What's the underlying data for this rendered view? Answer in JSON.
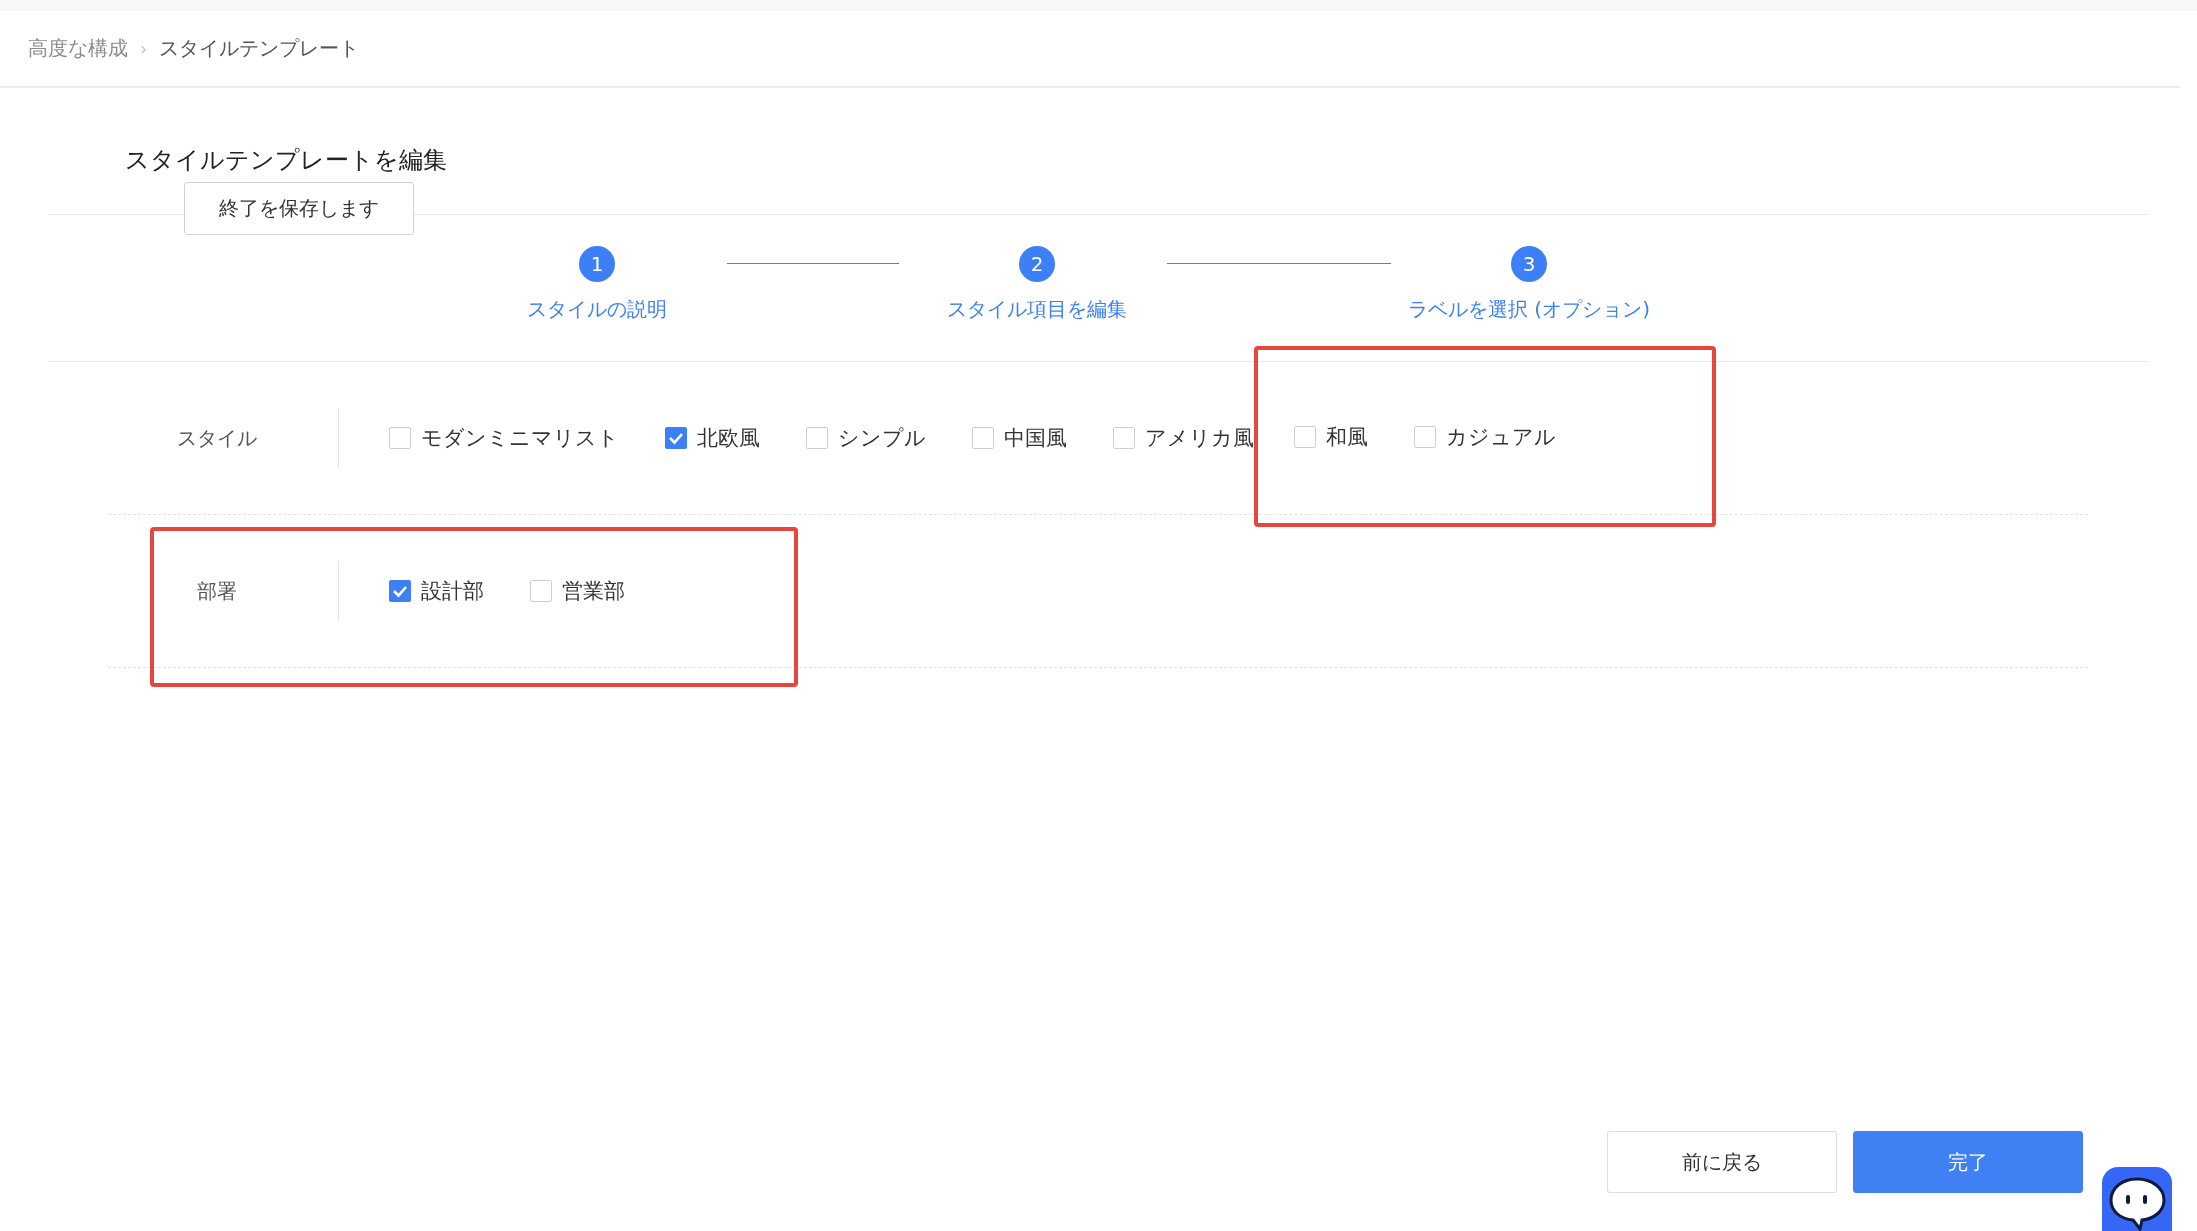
{
  "breadcrumb": [
    {
      "label": "高度な構成",
      "current": false
    },
    {
      "label": "スタイルテンプレート",
      "current": true
    }
  ],
  "breadcrumb_separator": "›",
  "title": "スタイルテンプレートを編集",
  "tooltip": "終了を保存します",
  "steps": [
    {
      "number": "1",
      "label": "スタイルの説明"
    },
    {
      "number": "2",
      "label": "スタイル項目を編集"
    },
    {
      "number": "3",
      "label": "ラベルを選択 (オプション)"
    }
  ],
  "rows": [
    {
      "label": "スタイル",
      "highlighted": false,
      "options": [
        {
          "label": "モダンミニマリスト",
          "checked": false,
          "highlighted": false
        },
        {
          "label": "北欧風",
          "checked": true,
          "highlighted": false
        },
        {
          "label": "シンプル",
          "checked": false,
          "highlighted": false
        },
        {
          "label": "中国風",
          "checked": false,
          "highlighted": false
        },
        {
          "label": "アメリカ風",
          "checked": false,
          "highlighted": false
        },
        {
          "label": "和風",
          "checked": false,
          "highlighted": true
        },
        {
          "label": "カジュアル",
          "checked": false,
          "highlighted": true
        }
      ]
    },
    {
      "label": "部署",
      "highlighted": true,
      "options": [
        {
          "label": "設計部",
          "checked": true,
          "highlighted": false
        },
        {
          "label": "営業部",
          "checked": false,
          "highlighted": false
        }
      ]
    }
  ],
  "buttons": [
    {
      "label": "前に戻る",
      "kind": "secondary"
    },
    {
      "label": "完了",
      "kind": "primary"
    }
  ]
}
